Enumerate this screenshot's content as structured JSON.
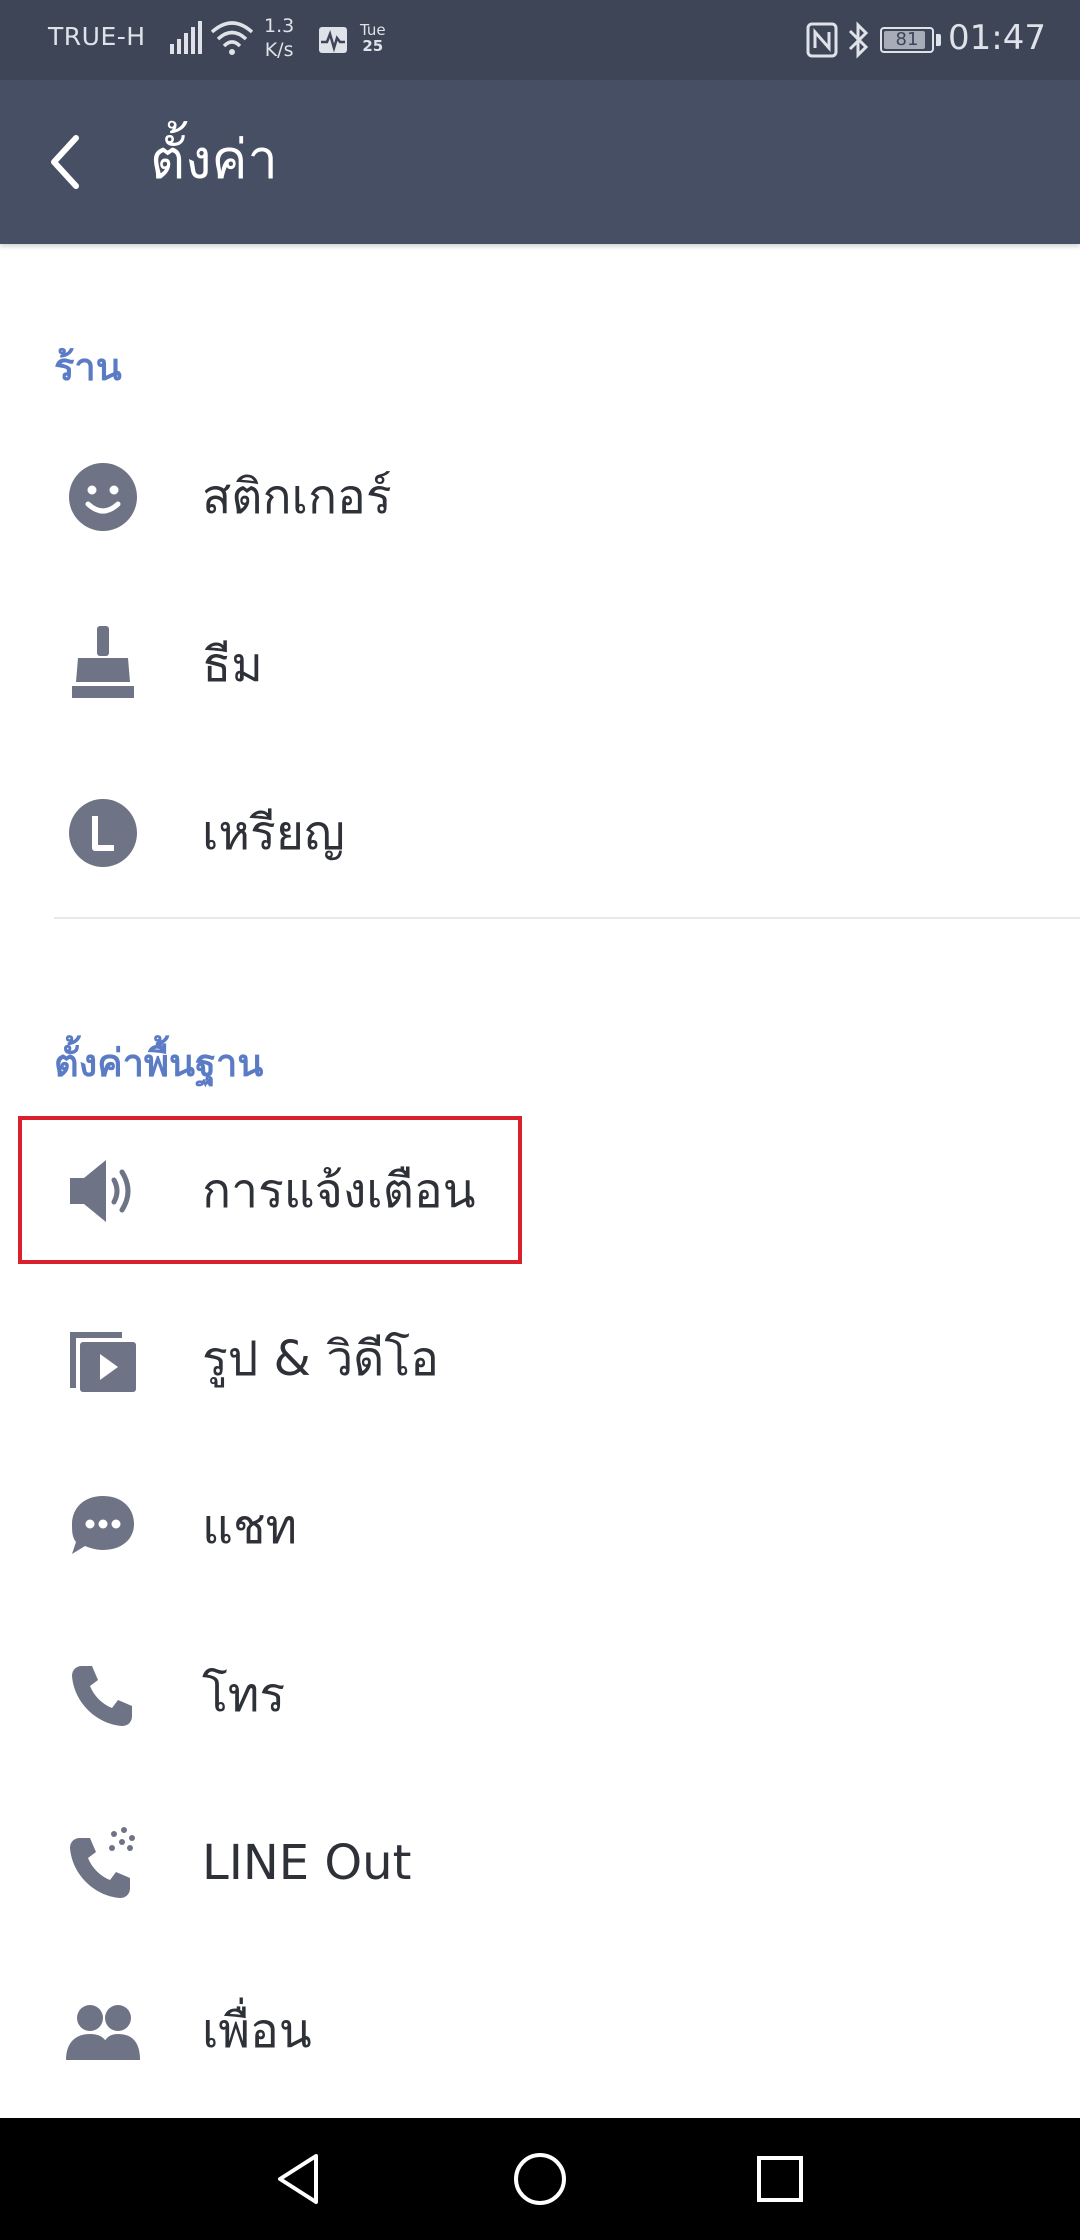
{
  "status_bar": {
    "carrier": "TRUE-H",
    "speed_value": "1.3",
    "speed_unit": "K/s",
    "day": "Tue",
    "date": "25",
    "battery": "81",
    "time": "01:47"
  },
  "header": {
    "title": "ตั้งค่า"
  },
  "sections": [
    {
      "title": "ร้าน",
      "items": [
        {
          "label": "สติกเกอร์",
          "icon": "smiley-icon"
        },
        {
          "label": "ธีม",
          "icon": "paint-brush-icon"
        },
        {
          "label": "เหรียญ",
          "icon": "coin-icon"
        }
      ]
    },
    {
      "title": "ตั้งค่าพื้นฐาน",
      "items": [
        {
          "label": "การแจ้งเตือน",
          "icon": "speaker-icon"
        },
        {
          "label": "รูป & วิดีโอ",
          "icon": "media-icon"
        },
        {
          "label": "แชท",
          "icon": "chat-icon"
        },
        {
          "label": "โทร",
          "icon": "phone-icon"
        },
        {
          "label": "LINE Out",
          "icon": "line-out-icon"
        },
        {
          "label": "เพื่อน",
          "icon": "friends-icon"
        }
      ]
    }
  ],
  "colors": {
    "status_bar": "#3d4556",
    "app_bar": "#474f64",
    "section_title": "#5b7cc4",
    "icon": "#6e7385",
    "highlight": "#d9202c"
  }
}
